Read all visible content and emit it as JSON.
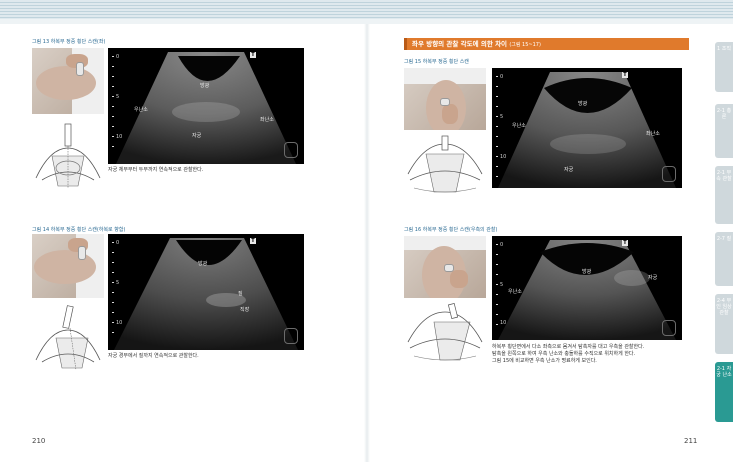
{
  "left_page": {
    "page_number": "210",
    "figures": [
      {
        "caption": "그림 13  하복부 정중 횡단 스캔(좌)",
        "us_labels": {
          "bladder": "방광",
          "ovary_left": "우난소",
          "uterus": "자궁",
          "ovary_right": "좌난소"
        },
        "depth_marks": [
          "0",
          "5",
          "10"
        ],
        "badge": "T",
        "description": "자궁 체부부터 두부까지 연속적으로 관찰한다."
      },
      {
        "caption": "그림 14  하복부 정중 횡단 스캔(하복로 향함)",
        "us_labels": {
          "bladder": "방광",
          "vagina": "질",
          "rectum": "직장"
        },
        "depth_marks": [
          "0",
          "5",
          "10"
        ],
        "badge": "T",
        "description": "자궁 경부에서 질까지 연속적으로 관찰한다."
      }
    ]
  },
  "right_page": {
    "page_number": "211",
    "section_title": "좌우 방향의 관찰 각도에 의한 차이",
    "section_title_ref": "(그림 15~17)",
    "figures": [
      {
        "caption": "그림 15  하복부 정중 횡단 스캔",
        "us_labels": {
          "bladder": "방광",
          "ovary_left": "우난소",
          "ovary_right": "좌난소",
          "uterus": "자궁"
        },
        "depth_marks": [
          "0",
          "5",
          "10"
        ],
        "badge": "T"
      },
      {
        "caption": "그림 16  하복부 정중 횡단 스캔(우측의 관찰)",
        "us_labels": {
          "bladder": "방광",
          "uterus": "자궁",
          "ovary": "우난소"
        },
        "depth_marks": [
          "0",
          "5",
          "10"
        ],
        "badge": "T",
        "description_lines": [
          "하복부 횡단면에서 다소 좌측으로 몸겨서 탐촉자를 대고 우측을 관찰한다.",
          "탐촉을 왼쪽으로 하여 우측 난소와 충돌하를 수직으로 위치하게 한다.",
          "그림 15에 비교하면 우측 난소가 명료하게 보인다."
        ]
      }
    ]
  },
  "side_tabs": [
    {
      "label": "1 조직",
      "color": "#cfd8dc"
    },
    {
      "label": "2-1 총론",
      "color": "#cfd8dc"
    },
    {
      "label": "2-1 부속 관찰",
      "color": "#cfd8dc"
    },
    {
      "label": "2-7 질",
      "color": "#cfd8dc"
    },
    {
      "label": "2-4 부인 임상 관찰",
      "color": "#cfd8dc"
    },
    {
      "label": "2-1 자궁 난소",
      "color": "#2a9a93"
    }
  ]
}
